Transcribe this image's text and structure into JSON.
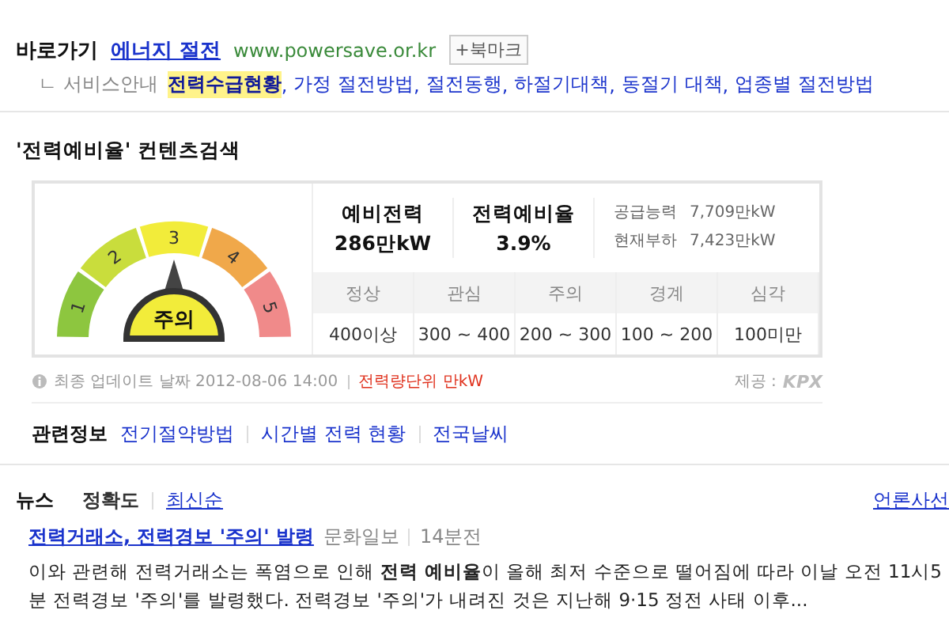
{
  "shortcut": {
    "label": "바로가기",
    "site_link": "에너지 절전",
    "url": "www.powersave.or.kr",
    "bookmark_button": "+북마크"
  },
  "service_guide": {
    "label": "ㄴ 서비스안내",
    "separator": ",",
    "links": [
      {
        "text": "전력수급현황",
        "selected": true
      },
      {
        "text": "가정 절전방법",
        "selected": false
      },
      {
        "text": "절전동행",
        "selected": false
      },
      {
        "text": "하절기대책",
        "selected": false
      },
      {
        "text": "동절기 대책",
        "selected": false
      },
      {
        "text": "업종별 절전방법",
        "selected": false
      }
    ]
  },
  "content_search": {
    "title": "'전력예비율' 컨텐츠검색",
    "gauge": {
      "center_label": "주의",
      "segments": [
        {
          "label": "1",
          "color": "#8dc63f",
          "selected": false
        },
        {
          "label": "2",
          "color": "#c9dd3c",
          "selected": false
        },
        {
          "label": "3",
          "color": "#f2ec3a",
          "selected": true
        },
        {
          "label": "4",
          "color": "#f0a84a",
          "selected": false
        },
        {
          "label": "5",
          "color": "#f08a8a",
          "selected": false
        }
      ]
    },
    "stats": [
      {
        "label": "예비전력",
        "value": "286만kW"
      },
      {
        "label": "전력예비율",
        "value": "3.9%"
      }
    ],
    "supply": [
      {
        "label": "공급능력",
        "value": "7,709만kW"
      },
      {
        "label": "현재부하",
        "value": "7,423만kW"
      }
    ],
    "levels": [
      {
        "name": "정상",
        "range": "400이상"
      },
      {
        "name": "관심",
        "range": "300 ~ 400"
      },
      {
        "name": "주의",
        "range": "200 ~ 300"
      },
      {
        "name": "경계",
        "range": "100 ~ 200"
      },
      {
        "name": "심각",
        "range": "100미만"
      }
    ],
    "updated": "최종 업데이트 날짜 2012-08-06 14:00",
    "unit": "전력량단위 만kW",
    "provider": "제공 :",
    "provider_logo": "KPX"
  },
  "related": {
    "label": "관련정보",
    "links": [
      "전기절약방법",
      "시간별 전력 현황",
      "전국날씨"
    ]
  },
  "news": {
    "title": "뉴스",
    "sort_options": [
      {
        "text": "정확도",
        "selected": true
      },
      {
        "text": "최신순",
        "selected": false
      }
    ],
    "press_link": "언론사선",
    "articles": [
      {
        "headline": "전력거래소, 전력경보 '주의' 발령",
        "source": "문화일보",
        "time": "14분전",
        "snippet": "이와 관련해 전력거래소는 폭염으로 인해 **전력 예비율**이 올해 최저 수준으로 떨어짐에 따라 이날 오전 11시5분 전력경보 '주의'를 발령했다. 전력경보 '주의'가 내려진 것은 지난해 9·15 정전 사태 이후..."
      }
    ]
  }
}
